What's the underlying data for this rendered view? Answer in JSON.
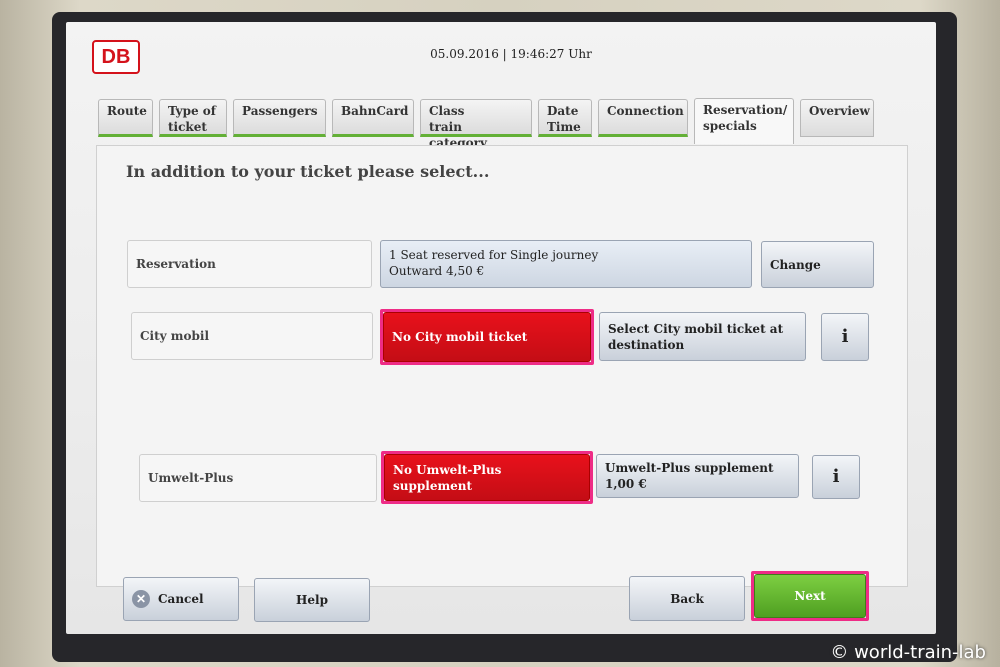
{
  "header": {
    "logo": "DB",
    "datetime": "05.09.2016 | 19:46:27 Uhr"
  },
  "tabs": [
    {
      "line1": "Route",
      "line2": ""
    },
    {
      "line1": "Type of",
      "line2": "ticket"
    },
    {
      "line1": "Passengers",
      "line2": ""
    },
    {
      "line1": "BahnCard",
      "line2": ""
    },
    {
      "line1": "Class",
      "line2": "train category"
    },
    {
      "line1": "Date",
      "line2": "Time"
    },
    {
      "line1": "Connection",
      "line2": ""
    },
    {
      "line1": "Reservation/",
      "line2": "specials"
    },
    {
      "line1": "Overview",
      "line2": ""
    }
  ],
  "main": {
    "heading": "In addition to your ticket please select...",
    "reservation": {
      "label": "Reservation",
      "value_line1": "1 Seat reserved for Single journey",
      "value_line2": "Outward 4,50 €",
      "change_label": "Change"
    },
    "city_mobil": {
      "label": "City mobil",
      "option_none": "No City mobil ticket",
      "option_select_line1": "Select City mobil ticket at",
      "option_select_line2": "destination",
      "info": "i"
    },
    "umwelt_plus": {
      "label": "Umwelt-Plus",
      "option_none": "No Umwelt-Plus supplement",
      "option_select_line1": "Umwelt-Plus supplement",
      "option_select_line2": "1,00 €",
      "info": "i"
    }
  },
  "footer": {
    "cancel": "Cancel",
    "help": "Help",
    "back": "Back",
    "next": "Next"
  },
  "watermark": "© world-train-lab",
  "colors": {
    "db_red": "#d4121b",
    "selected_red": "#e8111b",
    "next_green": "#5fb52c",
    "highlight_pink": "#ee2c86"
  }
}
